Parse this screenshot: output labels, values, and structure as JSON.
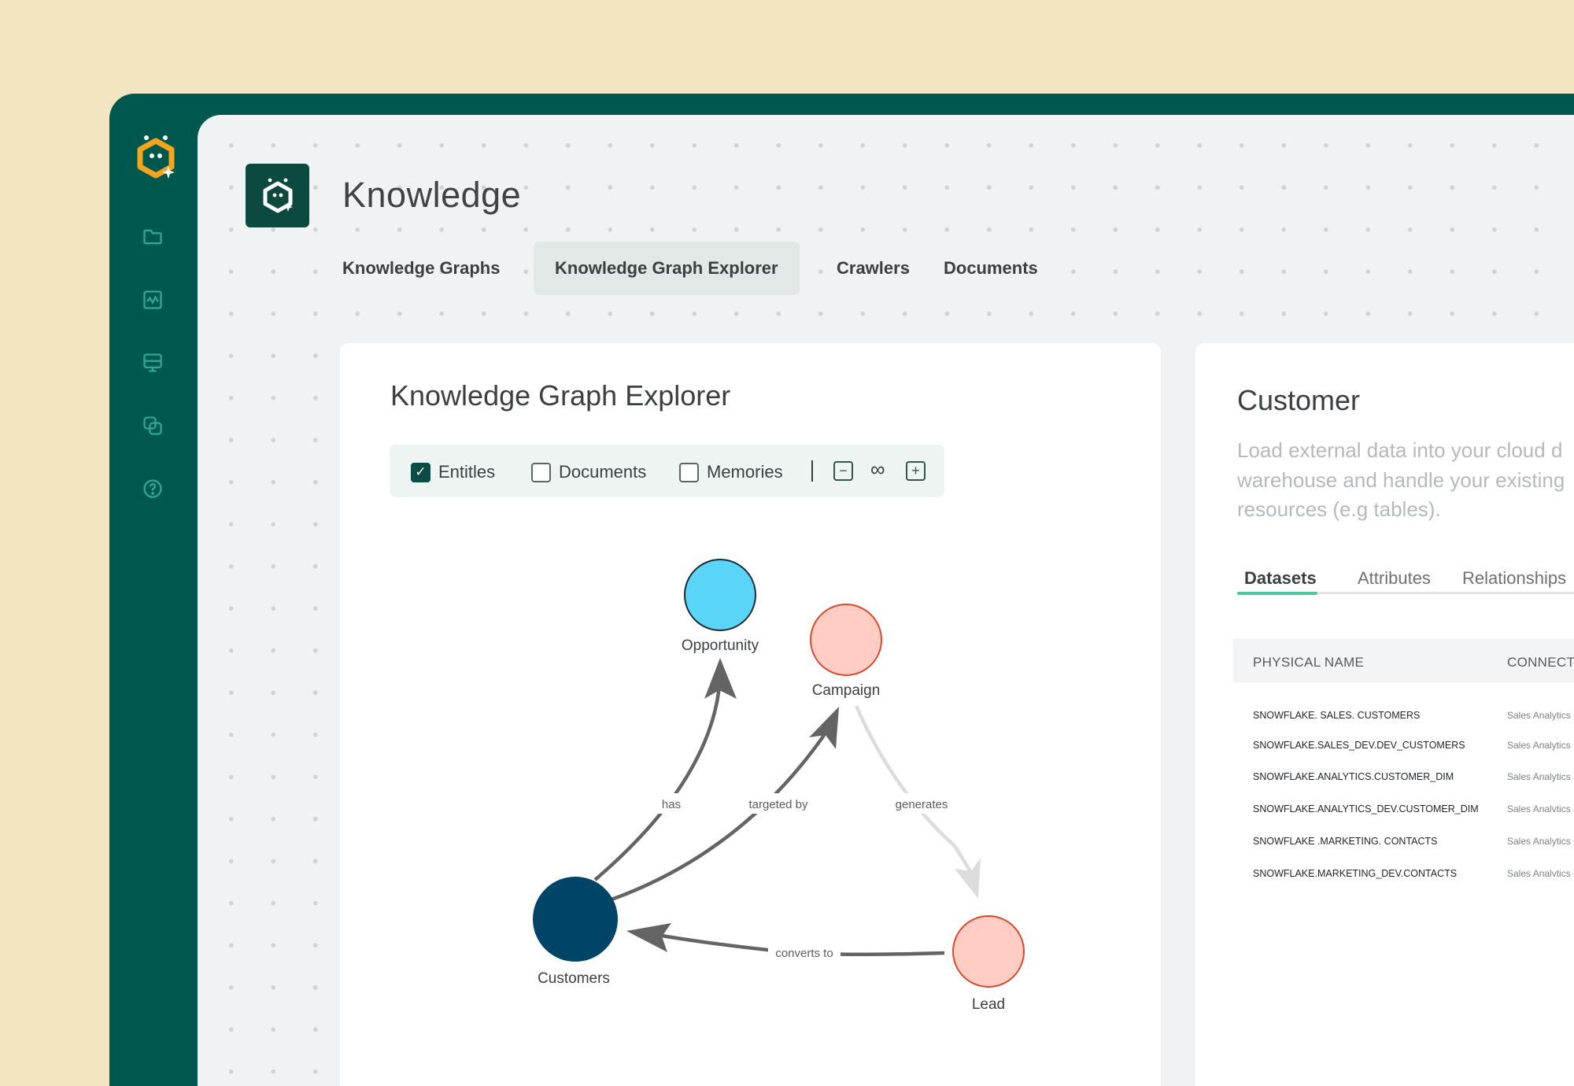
{
  "page": {
    "title": "Knowledge"
  },
  "tabs": [
    {
      "label": "Knowledge Graphs",
      "active": false
    },
    {
      "label": "Knowledge Graph Explorer",
      "active": true
    },
    {
      "label": "Crawlers",
      "active": false
    },
    {
      "label": "Documents",
      "active": false
    }
  ],
  "sidebar": {
    "icons": [
      "folder-icon",
      "activity-icon",
      "database-icon",
      "connections-icon",
      "help-icon"
    ]
  },
  "explorer": {
    "title": "Knowledge Graph Explorer",
    "filters": [
      {
        "label": "Entitles",
        "checked": true
      },
      {
        "label": "Documents",
        "checked": false
      },
      {
        "label": "Memories",
        "checked": false
      }
    ],
    "depth_label": "∞",
    "zoom_out": "−",
    "zoom_in": "+"
  },
  "graph": {
    "nodes": [
      {
        "label": "Opportunity",
        "color": "#5ad4f7",
        "stroke": "#1b2b33"
      },
      {
        "label": "Campaign",
        "color": "#ffcdc4",
        "stroke": "#d84a2a"
      },
      {
        "label": "Customers",
        "color": "#004468",
        "stroke": "#004468"
      },
      {
        "label": "Lead",
        "color": "#ffcdc4",
        "stroke": "#d84a2a"
      }
    ],
    "edges": [
      {
        "label": "has",
        "from": "Customers",
        "to": "Opportunity"
      },
      {
        "label": "targeted by",
        "from": "Customers",
        "to": "Campaign"
      },
      {
        "label": "generates",
        "from": "Campaign",
        "to": "Lead"
      },
      {
        "label": "converts to",
        "from": "Lead",
        "to": "Customers"
      }
    ]
  },
  "customer": {
    "title": "Customer",
    "description_lines": [
      "Load external data into your cloud d",
      "warehouse and handle your existing",
      "resources (e.g tables)."
    ],
    "tabs": [
      "Datasets",
      "Attributes",
      "Relationships"
    ],
    "table": {
      "columns": [
        "PHYSICAL NAME",
        "CONNECTI"
      ],
      "rows": [
        {
          "name": "SNOWFLAKE. SALES. CUSTOMERS",
          "connection": "Sales Analytics"
        },
        {
          "name": "SNOWFLAKE.SALES_DEV.DEV_CUSTOMERS",
          "connection": "Sales Analytics"
        },
        {
          "name": "SNOWFLAKE.ANALYTICS.CUSTOMER_DIM",
          "connection": "Sales Analytics"
        },
        {
          "name": "SNOWFLAKE.ANALYTICS_DEV.CUSTOMER_DIM",
          "connection": "Sales Analvtics"
        },
        {
          "name": "SNOWFLAKE .MARKETING. CONTACTS",
          "connection": "Sales Analytics"
        },
        {
          "name": "SNOWFLAKE.MARKETING_DEV.CONTACTS",
          "connection": "Sales Analvtics"
        }
      ]
    }
  },
  "colors": {
    "brand_dark": "#00574d",
    "accent": "#4cc8a1",
    "logo_orange": "#f4a51c"
  }
}
